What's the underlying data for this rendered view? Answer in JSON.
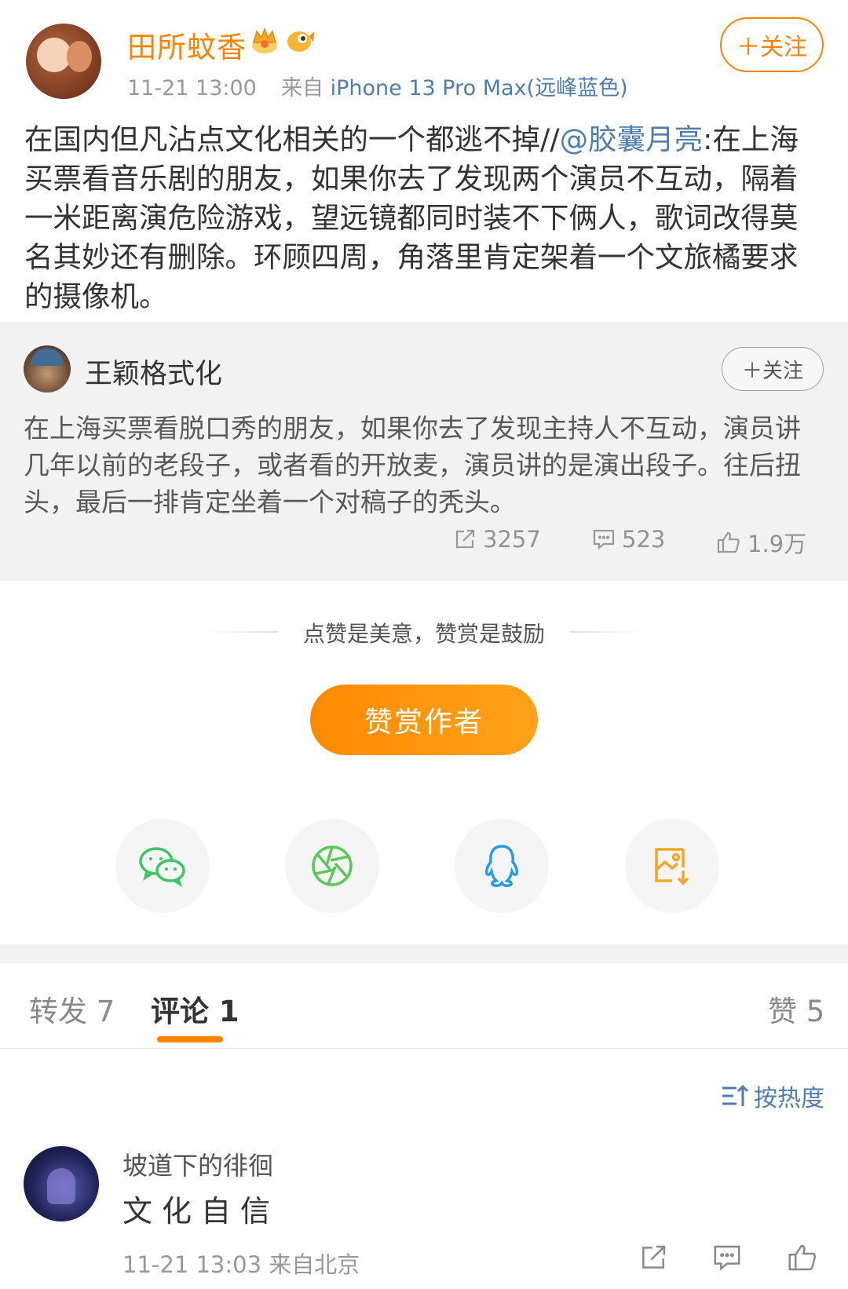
{
  "post": {
    "author_name": "田所蚊香",
    "time": "11-21 13:00",
    "source_prefix": "来自",
    "source": "iPhone 13 Pro Max(远峰蓝色)",
    "follow_label": "＋关注",
    "text_before_mention": "在国内但凡沾点文化相关的一个都逃不掉//",
    "mention": "@胶囊月亮",
    "text_after_mention": ":在上海买票看音乐剧的朋友，如果你去了发现两个演员不互动，隔着一米距离演危险游戏，望远镜都同时装不下俩人，歌词改得莫名其妙还有删除。环顾四周，角落里肯定架着一个文旅橘要求的摄像机。"
  },
  "retweet": {
    "author_name": "王颖格式化",
    "follow_label": "＋关注",
    "text": "在上海买票看脱口秀的朋友，如果你去了发现主持人不互动，演员讲几年以前的老段子，或者看的开放麦，演员讲的是演出段子。往后扭头，最后一排肯定坐着一个对稿子的秃头。",
    "reposts": "3257",
    "comments": "523",
    "likes": "1.9万"
  },
  "reward": {
    "tagline": "点赞是美意，赞赏是鼓励",
    "button_label": "赞赏作者"
  },
  "share": {
    "icons": [
      "wechat-icon",
      "moments-icon",
      "qq-icon",
      "save-image-icon"
    ]
  },
  "tabs": {
    "repost": "转发 7",
    "comment": "评论 1",
    "like": "赞 5",
    "active": "comment"
  },
  "sort": {
    "label": "按热度"
  },
  "comments": [
    {
      "author_name": "坡道下的徘徊",
      "text": "文化自信",
      "time": "11-21 13:03",
      "location": "来自北京"
    }
  ],
  "colors": {
    "accent": "#ff8200",
    "link": "#507daf",
    "wechat": "#3fc565",
    "moments": "#5ac85a",
    "qq": "#2a9af0",
    "save": "#f5a623"
  }
}
